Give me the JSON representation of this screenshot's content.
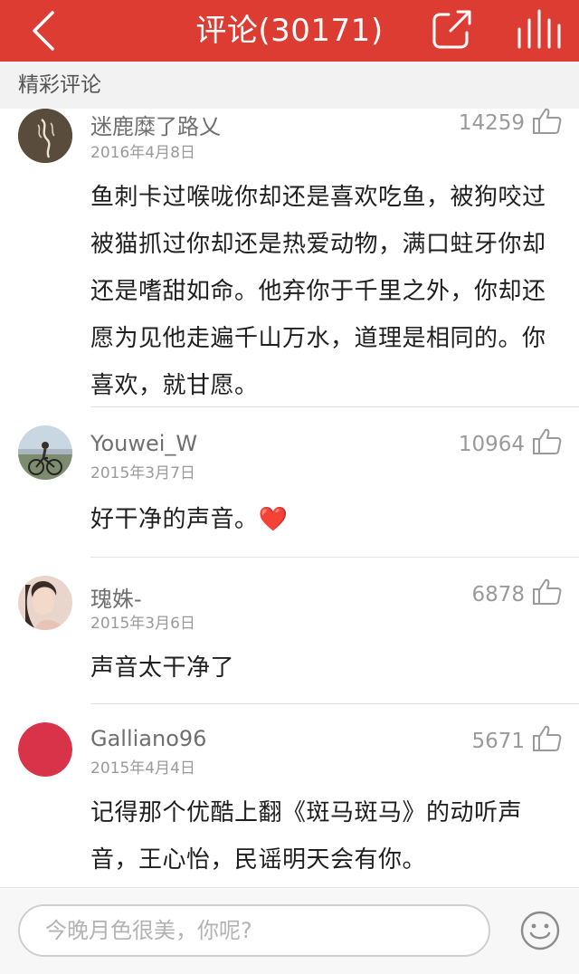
{
  "header": {
    "title": "评论(30171)",
    "background_color": "#dd3c33",
    "back_icon": "chevron-left-icon",
    "share_icon": "share-icon",
    "stats_icon": "bar-chart-icon"
  },
  "section": {
    "label": "精彩评论"
  },
  "comments": [
    {
      "username": "迷鹿糜了路乂",
      "date": "2016年4月8日",
      "likes": "14259",
      "body": "鱼刺卡过喉咙你却还是喜欢吃鱼，被狗咬过被猫抓过你却还是热爱动物，满口蛀牙你却还是嗜甜如命。他弃你于千里之外，你却还愿为见他走遍千山万水，道理是相同的。你喜欢，就甘愿。"
    },
    {
      "username": "Youwei_W",
      "date": "2015年3月7日",
      "likes": "10964",
      "body": "好干净的声音。",
      "emoji": "❤️"
    },
    {
      "username": "瑰姝-",
      "date": "2015年3月6日",
      "likes": "6878",
      "body": "声音太干净了"
    },
    {
      "username": "Galliano96",
      "date": "2015年4月4日",
      "likes": "5671",
      "body": "记得那个优酷上翻《斑马斑马》的动听声音，王心怡，民谣明天会有你。"
    }
  ],
  "input": {
    "placeholder": "今晚月色很美，你呢?",
    "value": "",
    "emoji_icon": "smiley-icon"
  }
}
